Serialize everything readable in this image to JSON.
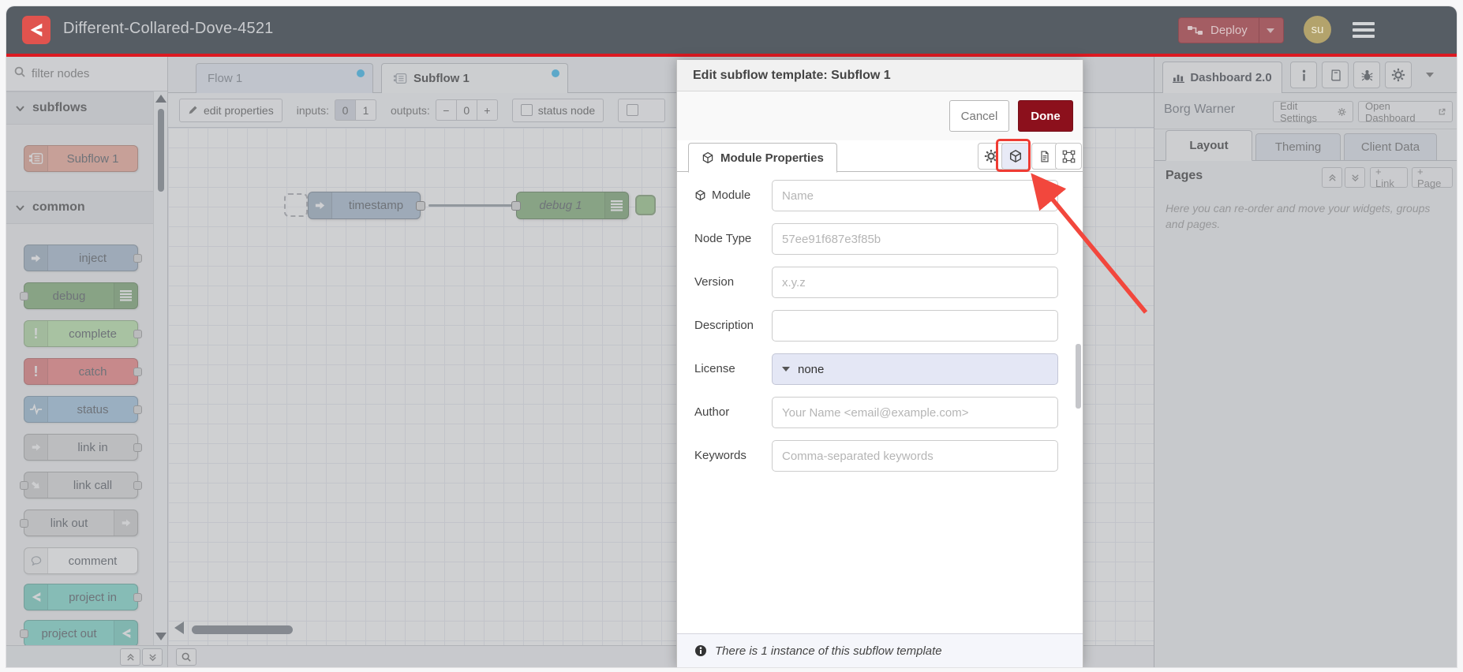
{
  "header": {
    "title": "Different-Collared-Dove-4521",
    "deploy_label": "Deploy",
    "avatar_initials": "su"
  },
  "palette": {
    "filter_placeholder": "filter nodes",
    "sections": [
      {
        "label": "subflows"
      },
      {
        "label": "common"
      }
    ],
    "subflows": [
      {
        "label": "Subflow 1"
      }
    ],
    "common": [
      {
        "label": "inject"
      },
      {
        "label": "debug"
      },
      {
        "label": "complete"
      },
      {
        "label": "catch"
      },
      {
        "label": "status"
      },
      {
        "label": "link in"
      },
      {
        "label": "link call"
      },
      {
        "label": "link out"
      },
      {
        "label": "comment"
      },
      {
        "label": "project in"
      },
      {
        "label": "project out"
      }
    ]
  },
  "workspace": {
    "tabs": [
      {
        "label": "Flow 1"
      },
      {
        "label": "Subflow 1"
      }
    ],
    "toolbar": {
      "edit_properties": "edit properties",
      "inputs_label": "inputs:",
      "input_zero": "0",
      "input_one": "1",
      "outputs_label": "outputs:",
      "minus": "−",
      "output_count": "0",
      "plus": "+",
      "status_node": "status node"
    },
    "nodes": [
      {
        "label": "timestamp"
      },
      {
        "label": "debug 1"
      }
    ]
  },
  "dialog": {
    "title": "Edit subflow template: Subflow 1",
    "cancel_label": "Cancel",
    "done_label": "Done",
    "tab_label": "Module Properties",
    "fields": [
      {
        "label": "Module",
        "placeholder": "Name"
      },
      {
        "label": "Node Type",
        "placeholder": "57ee91f687e3f85b"
      },
      {
        "label": "Version",
        "placeholder": "x.y.z"
      },
      {
        "label": "Description",
        "placeholder": ""
      },
      {
        "label": "License",
        "value": "none"
      },
      {
        "label": "Author",
        "placeholder": "Your Name <email@example.com>"
      },
      {
        "label": "Keywords",
        "placeholder": "Comma-separated keywords"
      }
    ],
    "footer_note": "There is 1 instance of this subflow template"
  },
  "sidebar": {
    "dashboard_tab": "Dashboard 2.0",
    "instance_name": "Borg Warner",
    "edit_settings_label": "Edit Settings",
    "open_dashboard_label": "Open Dashboard",
    "tabs": [
      {
        "label": "Layout"
      },
      {
        "label": "Theming"
      },
      {
        "label": "Client Data"
      }
    ],
    "pages_title": "Pages",
    "link_button": "+ Link",
    "page_button": "+ Page",
    "help_text": "Here you can re-order and move your widgets, groups and pages."
  },
  "colors": {
    "header_bg": "#565d64",
    "accent_red": "#8C101C",
    "deploy_muted": "#a45d63",
    "red_underline": "#dc1a22",
    "annotation_red": "#ef3b33",
    "tab_dot_blue": "#2fb7ef",
    "node_subflow": "#f0a896",
    "node_inject": "#a6bbcf",
    "node_debug": "#7fae74",
    "node_complete": "#b8e6a8",
    "node_catch": "#f07e7e",
    "node_status": "#9fc4e0",
    "node_link": "#dddddd",
    "node_comment": "#ffffff",
    "node_project": "#7adbcd",
    "license_field_bg": "#e4e7f5",
    "avatar_bg": "#b3a36c"
  }
}
